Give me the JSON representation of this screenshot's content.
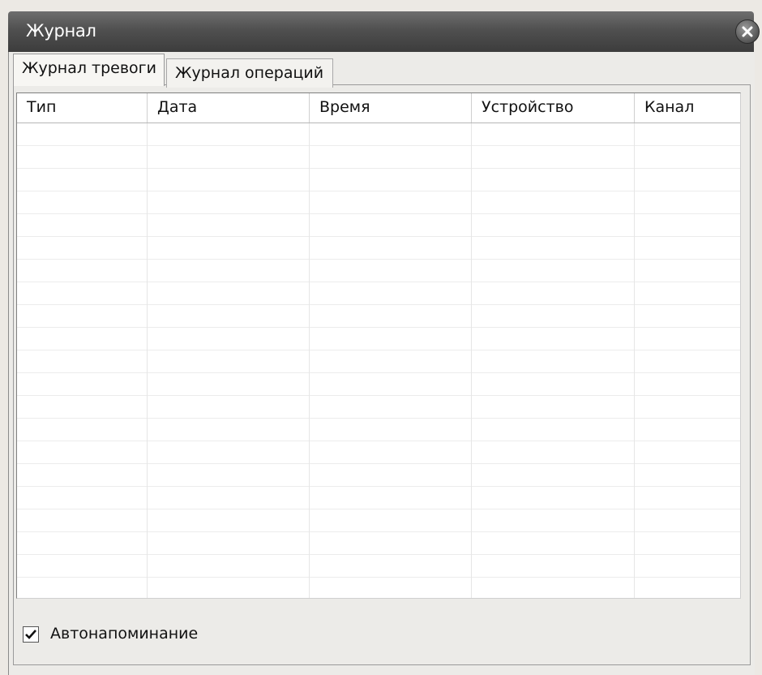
{
  "window": {
    "title": "Журнал",
    "close_icon": "close-icon"
  },
  "tabs": [
    {
      "label": "Журнал тревоги",
      "active": true
    },
    {
      "label": "Журнал операций",
      "active": false
    }
  ],
  "table": {
    "columns": [
      "Тип",
      "Дата",
      "Время",
      "Устройство",
      "Канал"
    ],
    "rows": []
  },
  "options": {
    "auto_reminder_label": "Автонапоминание",
    "auto_reminder_checked": true
  },
  "colors": {
    "titlebar": "#505050",
    "panel": "#ecebe8"
  }
}
